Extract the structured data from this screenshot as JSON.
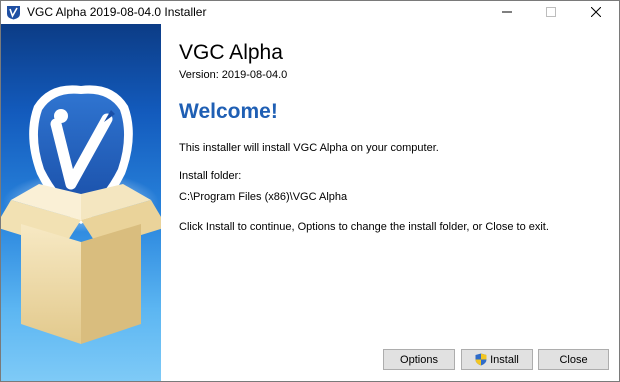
{
  "window": {
    "title": "VGC Alpha 2019-08-04.0 Installer",
    "controls": {
      "minimize_icon": "minimize-icon",
      "maximize_icon": "maximize-icon",
      "close_icon": "close-icon"
    }
  },
  "sidebar": {
    "icon": "vgc-logo-box-icon",
    "colors": {
      "gradient_top": "#0c3c86",
      "gradient_bottom": "#7ecaf7"
    }
  },
  "content": {
    "app_title": "VGC Alpha",
    "version": "Version: 2019-08-04.0",
    "welcome": "Welcome!",
    "intro": "This installer will install VGC Alpha on your computer.",
    "install_folder_label": "Install folder:",
    "install_folder_path": "C:\\Program Files (x86)\\VGC Alpha",
    "instructions": "Click Install to continue, Options to change the install folder, or Close to exit.",
    "welcome_color": "#1f5fb4"
  },
  "buttons": {
    "options_label": "Options",
    "install_label": "Install",
    "close_label": "Close",
    "install_icon": "uac-shield-icon"
  }
}
